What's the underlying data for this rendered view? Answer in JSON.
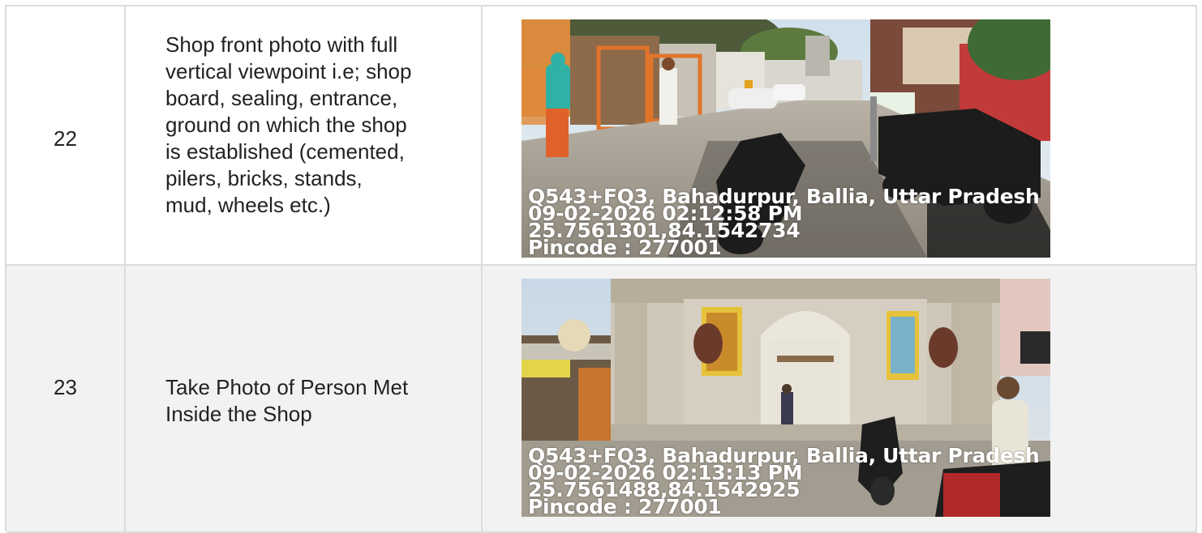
{
  "rows": [
    {
      "number": "22",
      "description": "Shop front photo with full\nvertical viewpoint i.e; shop\nboard, sealing, entrance,\nground on which the shop\nis established (cemented,\npilers, bricks, stands,\nmud, wheels etc.)",
      "photo": {
        "scene": "street shop front",
        "address": "Q543+FQ3, Bahadurpur, Ballia, Uttar Pradesh",
        "datetime": "09-02-2026 02:12:58 PM",
        "coords": "25.7561301,84.1542734",
        "pincode": "Pincode : 277001"
      }
    },
    {
      "number": "23",
      "description": "Take Photo of Person Met\nInside the Shop",
      "photo": {
        "scene": "temple gate street",
        "address": "Q543+FQ3, Bahadurpur, Ballia, Uttar Pradesh",
        "datetime": "09-02-2026 02:13:13 PM",
        "coords": "25.7561488,84.1542925",
        "pincode": "Pincode : 277001"
      }
    }
  ],
  "colors": {
    "border": "#dcdcdc",
    "row_alt_bg": "#f2f2f2",
    "text": "#222222"
  }
}
